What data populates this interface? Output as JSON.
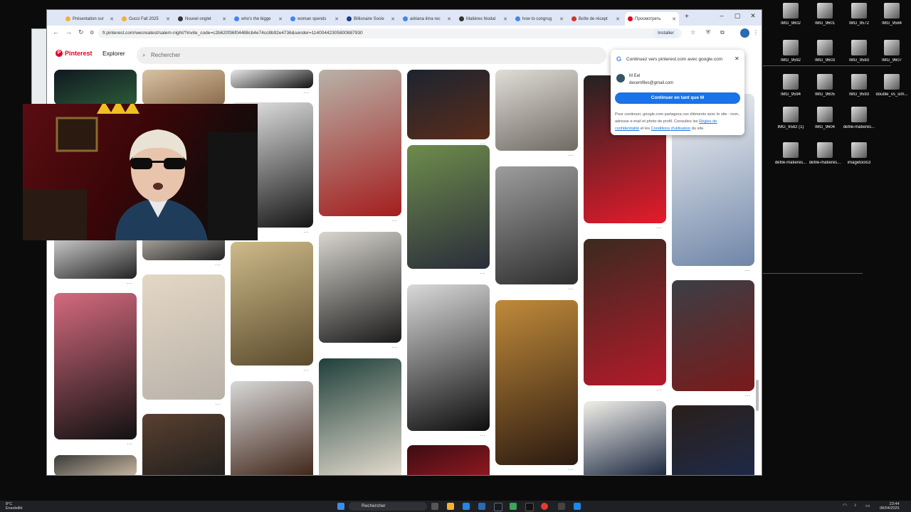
{
  "browser": {
    "tabs": [
      {
        "label": "Présentation sur",
        "color": "#f2b233"
      },
      {
        "label": "Gucci Fall 2025",
        "color": "#f2b233"
      },
      {
        "label": "Nouvel onglet",
        "color": "#333333"
      },
      {
        "label": "who's the bigge",
        "color": "#4285f4"
      },
      {
        "label": "woman spends",
        "color": "#4285f4"
      },
      {
        "label": "Billionaire Socie",
        "color": "#1a3b8f"
      },
      {
        "label": "adriana lima rec",
        "color": "#4285f4"
      },
      {
        "label": "Matières féodal",
        "color": "#333333"
      },
      {
        "label": "how to congrug",
        "color": "#4285f4"
      },
      {
        "label": "Boîte de récept",
        "color": "#d93025"
      },
      {
        "label": "Просмотреть",
        "color": "#e60023",
        "active": true
      }
    ],
    "url": "fr.pinterest.com/wecreatest/salem-night/?invite_code=c2b620f36f04488cb4e74cc8b92e4736&sender=11400442305800887930",
    "install_label": "Installer"
  },
  "pinterest": {
    "logo_text": "Pinterest",
    "explore_label": "Explorer",
    "search_placeholder": "Rechercher",
    "pins": [
      {
        "col": 0,
        "colors": [
          "#101820",
          "#2c5a3a"
        ]
      },
      {
        "col": 0,
        "colors": [
          "#eeeeee",
          "#222222"
        ]
      },
      {
        "col": 0,
        "colors": [
          "#d46a7e",
          "#111111"
        ]
      },
      {
        "col": 0,
        "colors": [
          "#3a3a3a",
          "#c9b8a0"
        ]
      },
      {
        "col": 1,
        "colors": [
          "#d9c3a5",
          "#8a6b4a"
        ]
      },
      {
        "col": 1,
        "colors": [
          "#cfc9c0",
          "#222222"
        ]
      },
      {
        "col": 1,
        "colors": [
          "#e4d7c4",
          "#b9b2aa"
        ]
      },
      {
        "col": 1,
        "colors": [
          "#5a4030",
          "#1b1b1b"
        ]
      },
      {
        "col": 2,
        "colors": [
          "#e8e8e8",
          "#111111"
        ]
      },
      {
        "col": 2,
        "colors": [
          "#e6e6e6",
          "#161616"
        ]
      },
      {
        "col": 2,
        "colors": [
          "#cdbb8a",
          "#5b4a2c"
        ]
      },
      {
        "col": 2,
        "colors": [
          "#d8d8d8",
          "#3b1f12"
        ]
      },
      {
        "col": 3,
        "colors": [
          "#b8b2a8",
          "#a41e1e"
        ]
      },
      {
        "col": 3,
        "colors": [
          "#d9d6cf",
          "#1a1a1a"
        ]
      },
      {
        "col": 3,
        "colors": [
          "#1f3f3a",
          "#f1e7d8"
        ]
      },
      {
        "col": 4,
        "colors": [
          "#1c2430",
          "#5a2c1a"
        ]
      },
      {
        "col": 4,
        "colors": [
          "#6e8c4c",
          "#2a2d3a"
        ]
      },
      {
        "col": 4,
        "colors": [
          "#d9d9d9",
          "#0d0d0d"
        ]
      },
      {
        "col": 4,
        "colors": [
          "#3b0d12",
          "#a01a24"
        ]
      },
      {
        "col": 5,
        "colors": [
          "#e0ddd7",
          "#6f6a62"
        ]
      },
      {
        "col": 5,
        "colors": [
          "#9d9d9d",
          "#2d2d2d"
        ]
      },
      {
        "col": 5,
        "colors": [
          "#c08a3a",
          "#2b1a10"
        ]
      },
      {
        "col": 6,
        "colors": [
          "#222222",
          "#e61b2b"
        ]
      },
      {
        "col": 6,
        "colors": [
          "#3a2a20",
          "#b31a2a"
        ]
      },
      {
        "col": 6,
        "colors": [
          "#f2f0ea",
          "#14213a"
        ]
      },
      {
        "col": 7,
        "colors": [
          "#f5f5f7",
          "#6f86a8"
        ]
      },
      {
        "col": 7,
        "colors": [
          "#3a3f45",
          "#7a1a1a"
        ]
      },
      {
        "col": 7,
        "colors": [
          "#2a1f1a",
          "#1d2a4a"
        ]
      }
    ]
  },
  "google_prompt": {
    "logo": "G",
    "title": "Continuez vers pinterest.com avec google.com",
    "account_name": "M Eel",
    "account_email": "decemfiles@gmail.com",
    "cta": "Continuer en tant que M",
    "legal_prefix": "Pour continuer, google.com partagera ces éléments avec le site : nom, adresse e-mail et photo de profil. Consultez les",
    "legal_link1": "Règles de confidentialité",
    "legal_mid": "et les",
    "legal_link2": "Conditions d'utilisation",
    "legal_suffix": "du site."
  },
  "desktop_icons": [
    {
      "label": "IMG_9602"
    },
    {
      "label": "IMG_9601"
    },
    {
      "label": "IMG_9572"
    },
    {
      "label": "IMG_9584"
    },
    {
      "label": "IMG_9592"
    },
    {
      "label": "IMG_9603"
    },
    {
      "label": "IMG_9583"
    },
    {
      "label": "IMG_9607"
    },
    {
      "label": "IMG_9594"
    },
    {
      "label": "IMG_9605"
    },
    {
      "label": "IMG_9593"
    },
    {
      "label": "double_vs_sim..."
    },
    {
      "label": "IMG_9582 (1)"
    },
    {
      "label": "IMG_9604"
    },
    {
      "label": "defile-matieres..."
    },
    {
      "label": "defile-matieres..."
    },
    {
      "label": "defile-matieres..."
    },
    {
      "label": "imagetools3"
    }
  ],
  "taskbar": {
    "weather_temp": "8°C",
    "weather_desc": "Ensoleillé",
    "search_label": "Rechercher",
    "time": "23:44",
    "date": "08/04/2025"
  }
}
